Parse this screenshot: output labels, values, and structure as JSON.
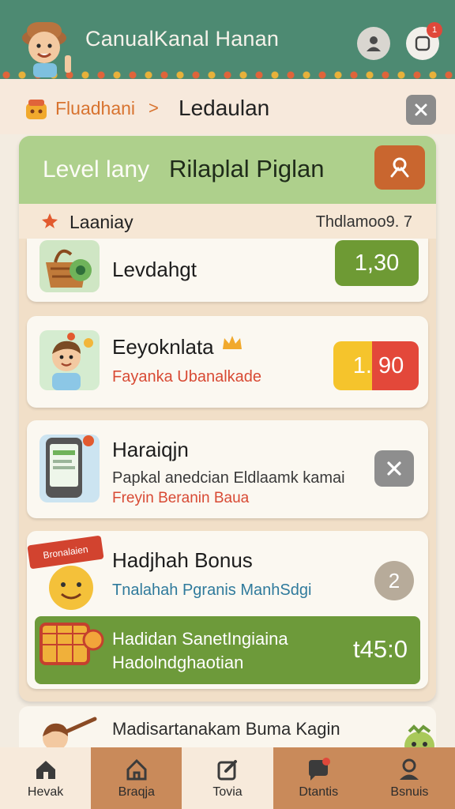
{
  "header": {
    "title": "CanualKanal Hanan",
    "notification_badge": "1"
  },
  "breadcrumb": {
    "parent": "Fluadhani",
    "separator": ">",
    "current": "Ledaulan"
  },
  "panel": {
    "level_label": "Level lany",
    "plan_title": "Rilaplal Piglan",
    "section_title": "Laaniay",
    "section_meta": "Thdlamoo9. 7"
  },
  "cards": [
    {
      "title": "Levdahgt",
      "value": "1,30",
      "value_color": "#6e9a34"
    },
    {
      "title": "Eeyoknlata",
      "subtitle": "Fayanka Ubanalkade",
      "value": "1. 90",
      "value_color": "#e3483a"
    },
    {
      "title": "Haraiqjn",
      "subtitle": "Papkal anedcian Eldlaamk kamai",
      "subtitle2": "Freyin Beranin Baua"
    },
    {
      "ribbon": "Bronalaien",
      "title": "Hadjhah Bonus",
      "subtitle": "Tnalahah Pgranis ManhSdgi",
      "badge": "2",
      "bonus_line1": "Hadidan SanetIngiaina",
      "bonus_line2": "Hadolndghaotian",
      "bonus_amount": "t45:0"
    }
  ],
  "lower_card": {
    "title": "Madisartanakam Buma Kagin"
  },
  "tabs": [
    {
      "label": "Hevak",
      "icon": "home-icon"
    },
    {
      "label": "Braqja",
      "icon": "house-icon"
    },
    {
      "label": "Tovia",
      "icon": "edit-icon"
    },
    {
      "label": "Dtantis",
      "icon": "chat-icon"
    },
    {
      "label": "Bsnuis",
      "icon": "user-icon"
    }
  ],
  "colors": {
    "header": "#4d8a72",
    "accent_orange": "#d8732f",
    "green": "#6d9a3a",
    "red": "#e3483a",
    "yellow": "#f5c42c"
  }
}
